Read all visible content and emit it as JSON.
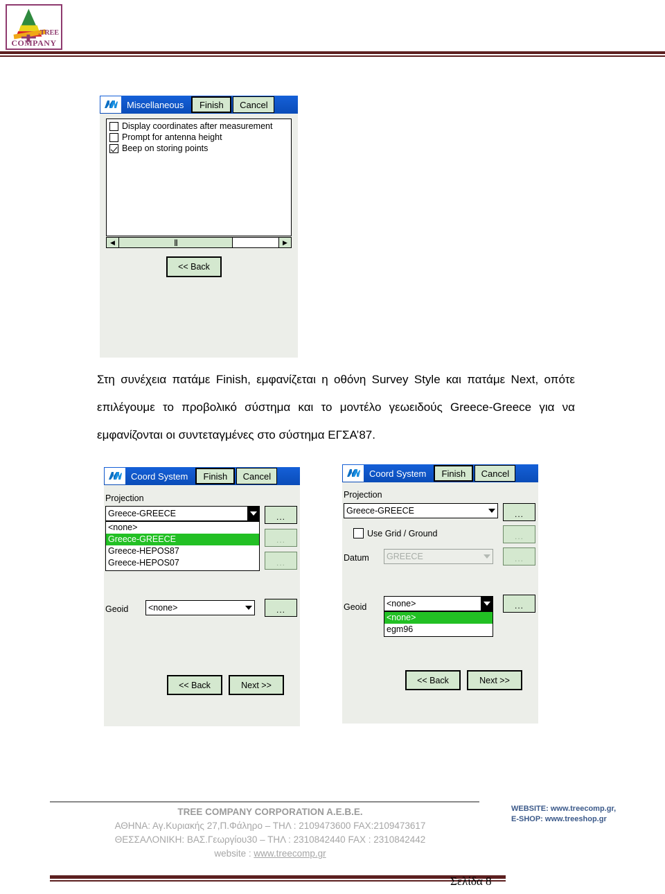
{
  "header": {
    "logo": {
      "tree_label": ".TREE",
      "wordmark": "COMPANY",
      "icon": "tree-logo"
    }
  },
  "dialog_misc": {
    "titlebar": {
      "icon": "nikon-app-icon",
      "title": "Miscellaneous",
      "finish_label": "Finish",
      "cancel_label": "Cancel"
    },
    "options": [
      {
        "label": "Display coordinates after measurement",
        "checked": false
      },
      {
        "label": "Prompt for antenna height",
        "checked": false
      },
      {
        "label": "Beep on storing points",
        "checked": true
      }
    ],
    "scrollbar": {
      "left_arrow": "◀",
      "right_arrow": "▶",
      "thumb_grip": "|||"
    },
    "back_label": "<< Back"
  },
  "paragraph": {
    "text": "Στη συνέχεια πατάμε Finish, εμφανίζεται η οθόνη Survey Style και πατάμε Next, οπότε επιλέγουμε το προβολικό σύστημα και το μοντέλο γεωειδούς Greece-Greece για να εμφανίζονται οι συντεταγμένες στο σύστημα ΕΓΣΑ’87."
  },
  "dialog_coord_left": {
    "titlebar": {
      "icon": "nikon-app-icon",
      "title": "Coord System",
      "finish_label": "Finish",
      "cancel_label": "Cancel"
    },
    "projection_label": "Projection",
    "projection_value": "Greece-GREECE",
    "projection_options": [
      {
        "label": "<none>",
        "selected": false
      },
      {
        "label": "Greece-GREECE",
        "selected": true
      },
      {
        "label": "Greece-HEPOS87",
        "selected": false
      },
      {
        "label": "Greece-HEPOS07",
        "selected": false
      }
    ],
    "ellipsis_label": "...",
    "geoid_label": "Geoid",
    "geoid_value": "<none>",
    "back_label": "<< Back",
    "next_label": "Next >>"
  },
  "dialog_coord_right": {
    "titlebar": {
      "icon": "nikon-app-icon",
      "title": "Coord System",
      "finish_label": "Finish",
      "cancel_label": "Cancel"
    },
    "projection_label": "Projection",
    "projection_value": "Greece-GREECE",
    "grid_ground_label": "Use Grid / Ground",
    "grid_ground_checked": false,
    "datum_label": "Datum",
    "datum_value": "GREECE",
    "ellipsis_label": "...",
    "geoid_label": "Geoid",
    "geoid_value": "<none>",
    "geoid_options": [
      {
        "label": "<none>",
        "selected": true
      },
      {
        "label": "egm96",
        "selected": false
      }
    ],
    "back_label": "<< Back",
    "next_label": "Next >>"
  },
  "footer": {
    "company": "TREE COMPANY CORPORATION A.E.B.E.",
    "athens": "ΑΘΗΝΑ: Αγ.Κυριακής 27,Π.Φάληρο – ΤΗΛ : 2109473600 FAX:2109473617",
    "thessaloniki": "ΘΕΣΣΑΛΟΝΙΚΗ: ΒΑΣ.Γεωργίου30 – ΤΗΛ : 2310842440  FAX : 2310842442",
    "website_prefix": "website : ",
    "website_link": "www.treecomp.gr",
    "right_line1": "WEBSITE: www.treecomp.gr,",
    "right_line2": "E-SHOP: www.treeshop.gr",
    "page_number": "Σελίδα 8"
  },
  "colors": {
    "titlebar_blue": "#0a4cb8",
    "button_green": "#d4e8cf",
    "highlight_green": "#22c024",
    "rule_maroon": "#5c1f1f",
    "logo_purple": "#8e3a6e"
  }
}
